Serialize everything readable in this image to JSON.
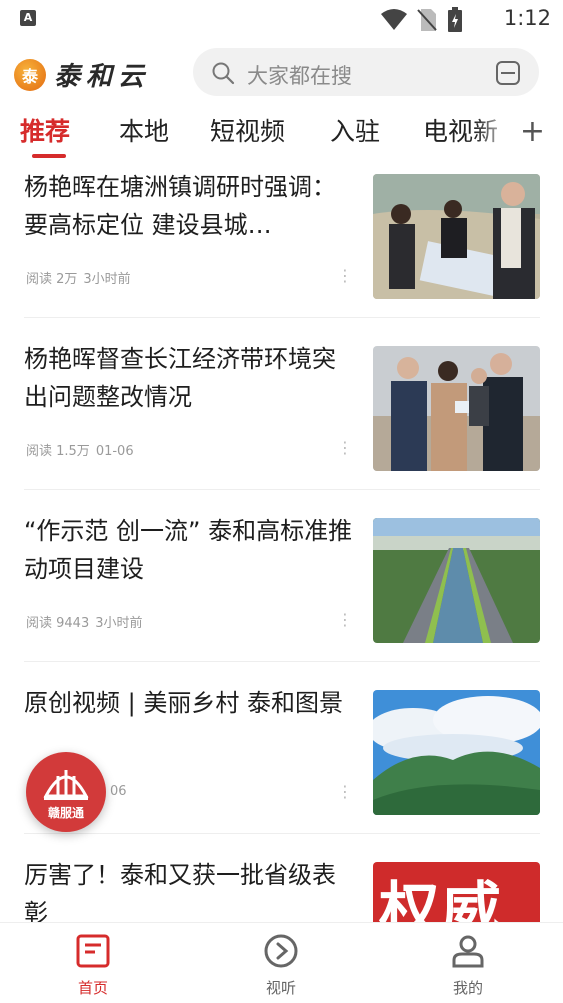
{
  "status_bar": {
    "indicator": "A",
    "time": "1:12",
    "icons": [
      "wifi-icon",
      "no-sim-icon",
      "battery-charging-icon"
    ]
  },
  "header": {
    "logo_badge": "泰",
    "app_name": "泰和云",
    "search_placeholder": "大家都在搜"
  },
  "tabs": [
    "推荐",
    "本地",
    "短视频",
    "入驻",
    "电视新"
  ],
  "active_tab": 0,
  "articles": [
    {
      "title": "杨艳晖在塘洲镇调研时强调：要高标定位 建设县城…",
      "reads": "阅读 2万",
      "time": "3小时前",
      "thumb": "officials-with-map"
    },
    {
      "title": "杨艳晖督查长江经济带环境突出问题整改情况",
      "reads": "阅读 1.5万",
      "time": "01-06",
      "thumb": "officials-riverside"
    },
    {
      "title": "“作示范 创一流” 泰和高标准推动项目建设",
      "reads": "阅读 9443",
      "time": "3小时前",
      "thumb": "aerial-boulevard"
    },
    {
      "title": "原创视频 | 美丽乡村 泰和图景",
      "reads": "",
      "time": "06",
      "thumb": "mountain-clouds"
    },
    {
      "title": "厉害了！泰和又获一批省级表彰",
      "reads": "",
      "time": "",
      "thumb": "red-banner",
      "thumb_text": "权威"
    }
  ],
  "floating_badge": {
    "label": "赣服通"
  },
  "bottom_nav": [
    {
      "label": "首页",
      "icon": "home-news-icon",
      "active": true
    },
    {
      "label": "视听",
      "icon": "play-circle-icon",
      "active": false
    },
    {
      "label": "我的",
      "icon": "user-icon",
      "active": false
    }
  ],
  "colors": {
    "accent": "#d62b2b",
    "text": "#1e1e1e",
    "muted": "#9a9a9a"
  }
}
